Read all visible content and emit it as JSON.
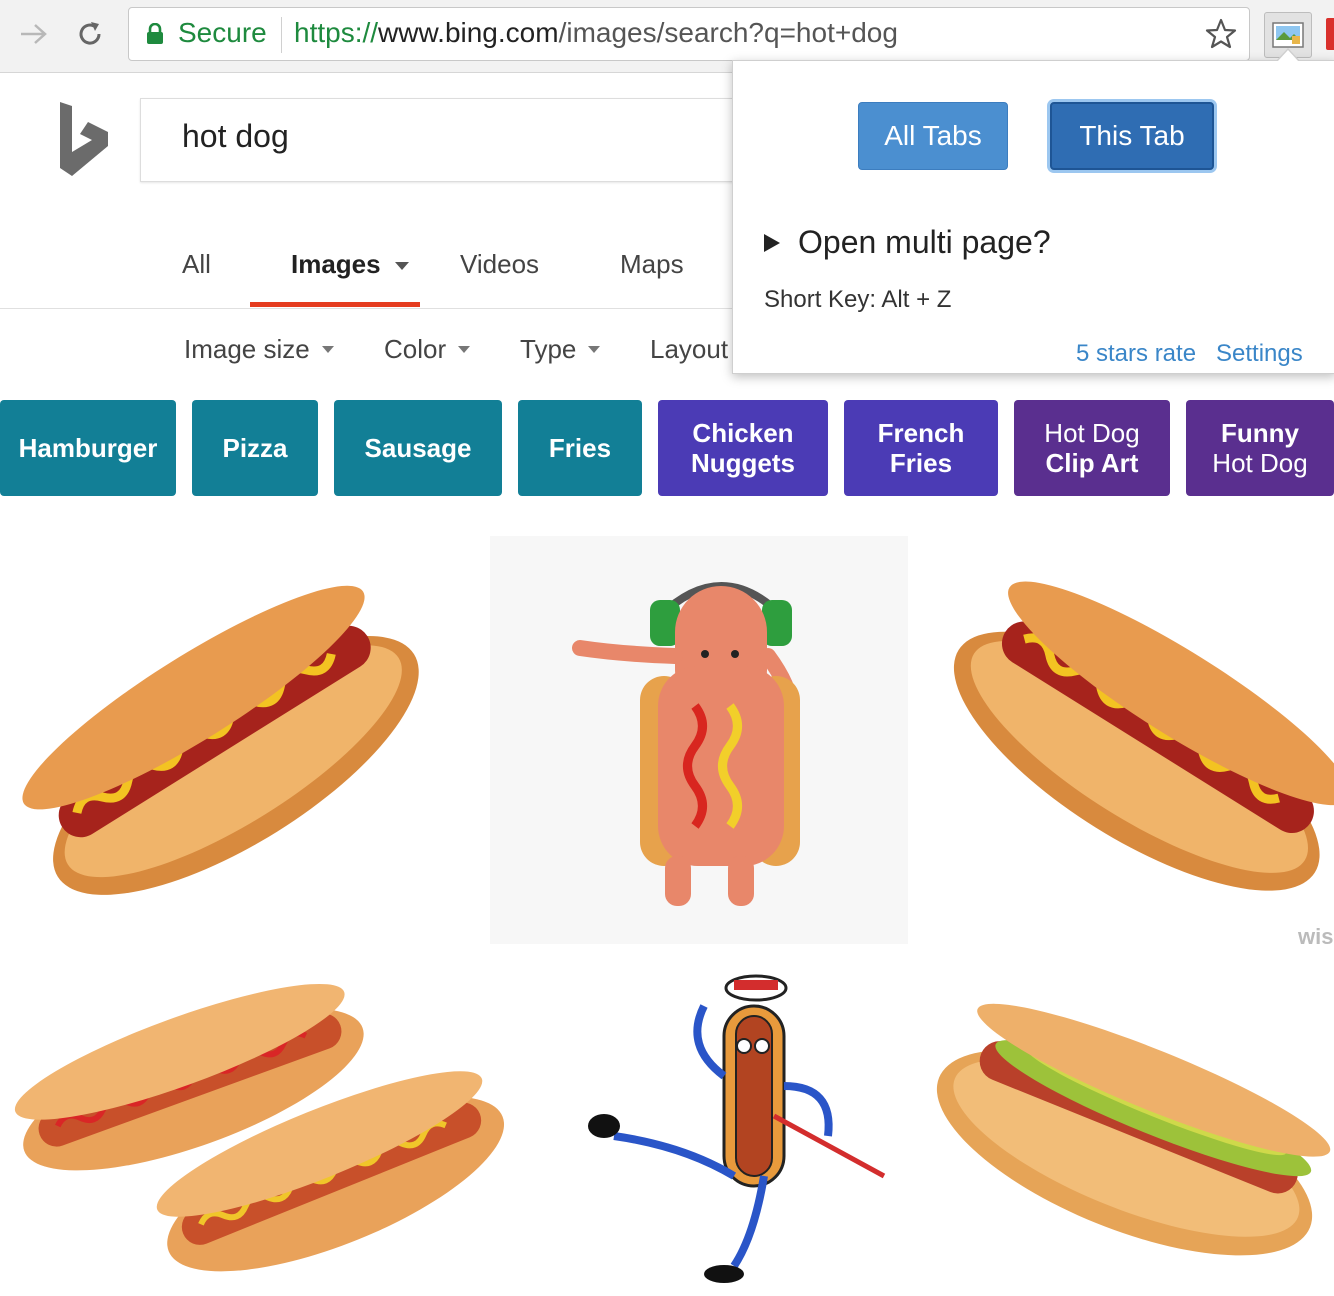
{
  "browser": {
    "secure_label": "Secure",
    "url_scheme": "https://",
    "url_host": "www.bing.com",
    "url_path": "/images/search?q=hot+dog"
  },
  "search": {
    "query": "hot dog"
  },
  "tabs": [
    "All",
    "Images",
    "Videos",
    "Maps"
  ],
  "filters": [
    "Image size",
    "Color",
    "Type",
    "Layout"
  ],
  "related": [
    {
      "label": "Hamburger"
    },
    {
      "label": "Pizza"
    },
    {
      "label": "Sausage"
    },
    {
      "label": "Fries"
    },
    {
      "label_l1": "Chicken",
      "label_l2": "Nuggets"
    },
    {
      "label_l1": "French",
      "label_l2": "Fries"
    },
    {
      "label_l1": "Hot Dog",
      "label_l2": "Clip Art"
    },
    {
      "label_l1": "Funny",
      "label_l2": "Hot Dog"
    }
  ],
  "popup": {
    "all_tabs": "All Tabs",
    "this_tab": "This Tab",
    "multi_page": "Open multi page?",
    "shortkey": "Short Key: Alt + Z",
    "rate": "5 stars rate",
    "settings": "Settings"
  },
  "watermark": "wis",
  "colors": {
    "accent_underline": "#e53c1f",
    "chip_teal": "#127f96",
    "chip_indigo": "#4b3bb5",
    "chip_purple": "#5a2f8f",
    "link_blue": "#3a86c8",
    "secure_green": "#1e8a3e"
  }
}
